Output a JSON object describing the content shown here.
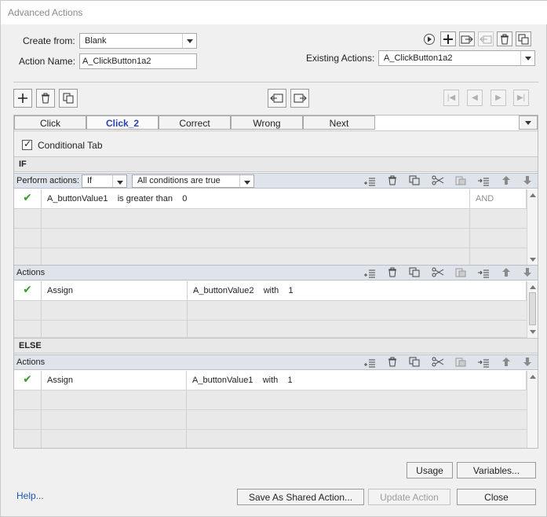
{
  "window": {
    "title": "Advanced Actions"
  },
  "form": {
    "create_from_label": "Create from:",
    "create_from_value": "Blank",
    "action_name_label": "Action Name:",
    "action_name_value": "A_ClickButton1a2",
    "existing_actions_label": "Existing Actions:",
    "existing_actions_value": "A_ClickButton1a2"
  },
  "tabs": [
    {
      "label": "Click",
      "active": false
    },
    {
      "label": "Click_2",
      "active": true
    },
    {
      "label": "Correct",
      "active": false
    },
    {
      "label": "Wrong",
      "active": false
    },
    {
      "label": "Next",
      "active": false
    }
  ],
  "conditional_tab_label": "Conditional Tab",
  "conditional_tab_checked": true,
  "if_section": {
    "header": "IF",
    "perform_actions_label": "Perform actions:",
    "perform_value": "If",
    "conditions_value": "All conditions are true",
    "condition_row": {
      "operand1": "A_buttonValue1",
      "operator": "is greater than",
      "operand2": "0",
      "connector": "AND"
    }
  },
  "actions_section": {
    "label": "Actions",
    "row": {
      "action": "Assign",
      "target": "A_buttonValue2",
      "with_label": "with",
      "value": "1"
    }
  },
  "else_section": {
    "header": "ELSE",
    "actions_label": "Actions",
    "row": {
      "action": "Assign",
      "target": "A_buttonValue1",
      "with_label": "with",
      "value": "1"
    }
  },
  "buttons": {
    "usage": "Usage",
    "variables": "Variables...",
    "help": "Help...",
    "save_shared": "Save As Shared Action...",
    "update": "Update Action",
    "close": "Close"
  },
  "colors": {
    "accent": "#2a3fb0",
    "check_green": "#3a9c2c",
    "link": "#1a56b0"
  }
}
